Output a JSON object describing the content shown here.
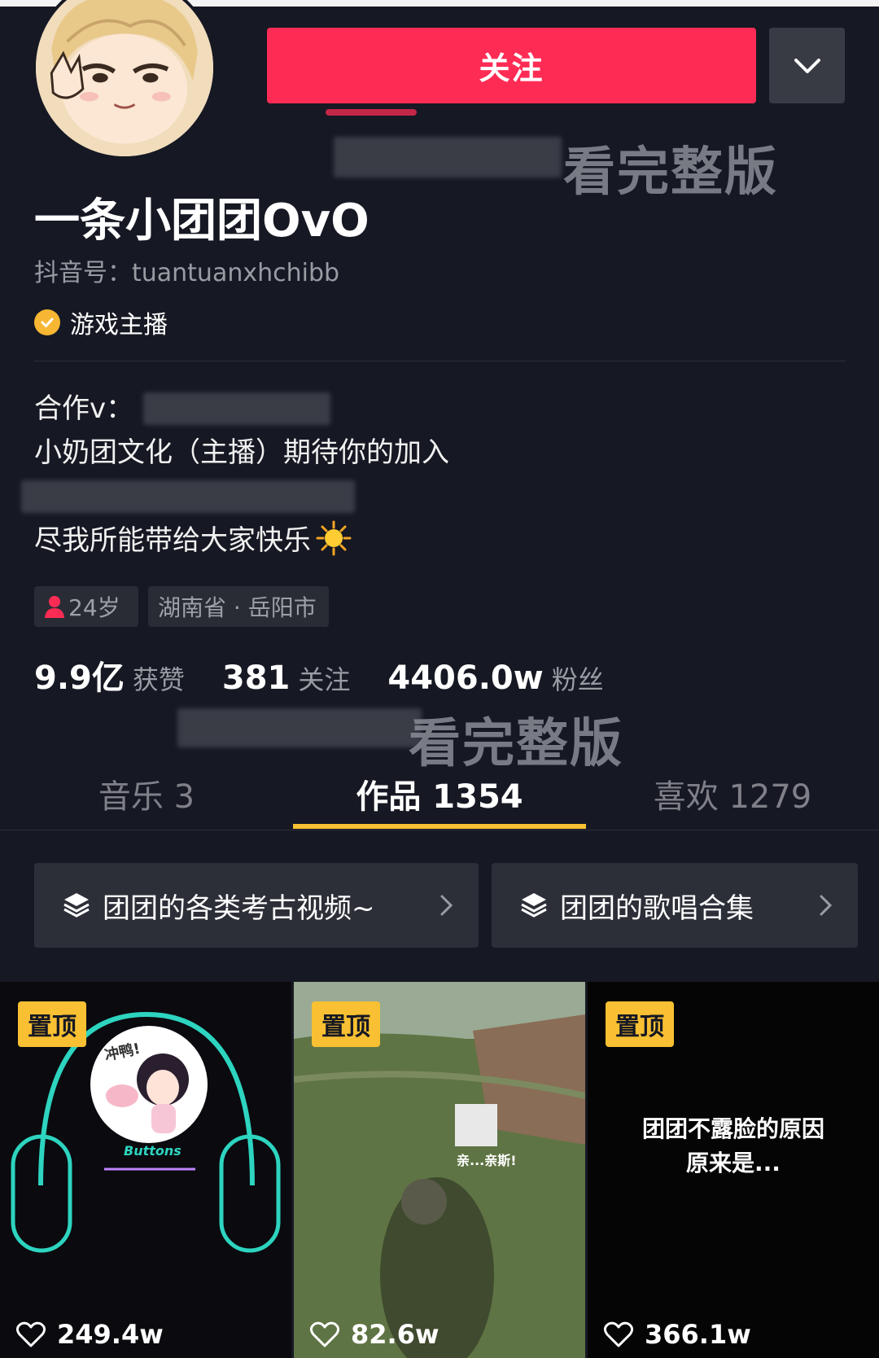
{
  "header": {
    "follow_label": "关注",
    "more_icon": "chevron-down-icon"
  },
  "watermarks": {
    "top": "看完整版",
    "middle": "看完整版"
  },
  "profile": {
    "nickname": "一条小团团OvO",
    "douyin_id": "抖音号：tuantuanxhchibb",
    "verified_label": "游戏主播",
    "bio": {
      "line1": "合作v：",
      "line2": "小奶团文化（主播）期待你的加入",
      "line4": "尽我所能带给大家快乐"
    },
    "tags": {
      "age": "24岁",
      "location": "湖南省 · 岳阳市"
    }
  },
  "stats": {
    "likes_num": "9.9亿",
    "likes_label": "获赞",
    "following_num": "381",
    "following_label": "关注",
    "fans_num": "4406.0w",
    "fans_label": "粉丝"
  },
  "tabs": {
    "music": "音乐 3",
    "works": "作品 1354",
    "likes": "喜欢 1279"
  },
  "collections": {
    "c1": "团团的各类考古视频~",
    "c2": "团团的歌唱合集"
  },
  "videos": [
    {
      "pin": "置顶",
      "likes": "249.4w",
      "thumb_text": "Buttons",
      "sticker_text": "冲鸭!"
    },
    {
      "pin": "置顶",
      "likes": "82.6w",
      "sticker_text": "亲...亲斯!"
    },
    {
      "pin": "置顶",
      "likes": "366.1w",
      "caption": "团团不露脸的原因原来是..."
    }
  ],
  "colors": {
    "background": "#161823",
    "follow": "#fe2c55",
    "accent": "#f8c032"
  }
}
